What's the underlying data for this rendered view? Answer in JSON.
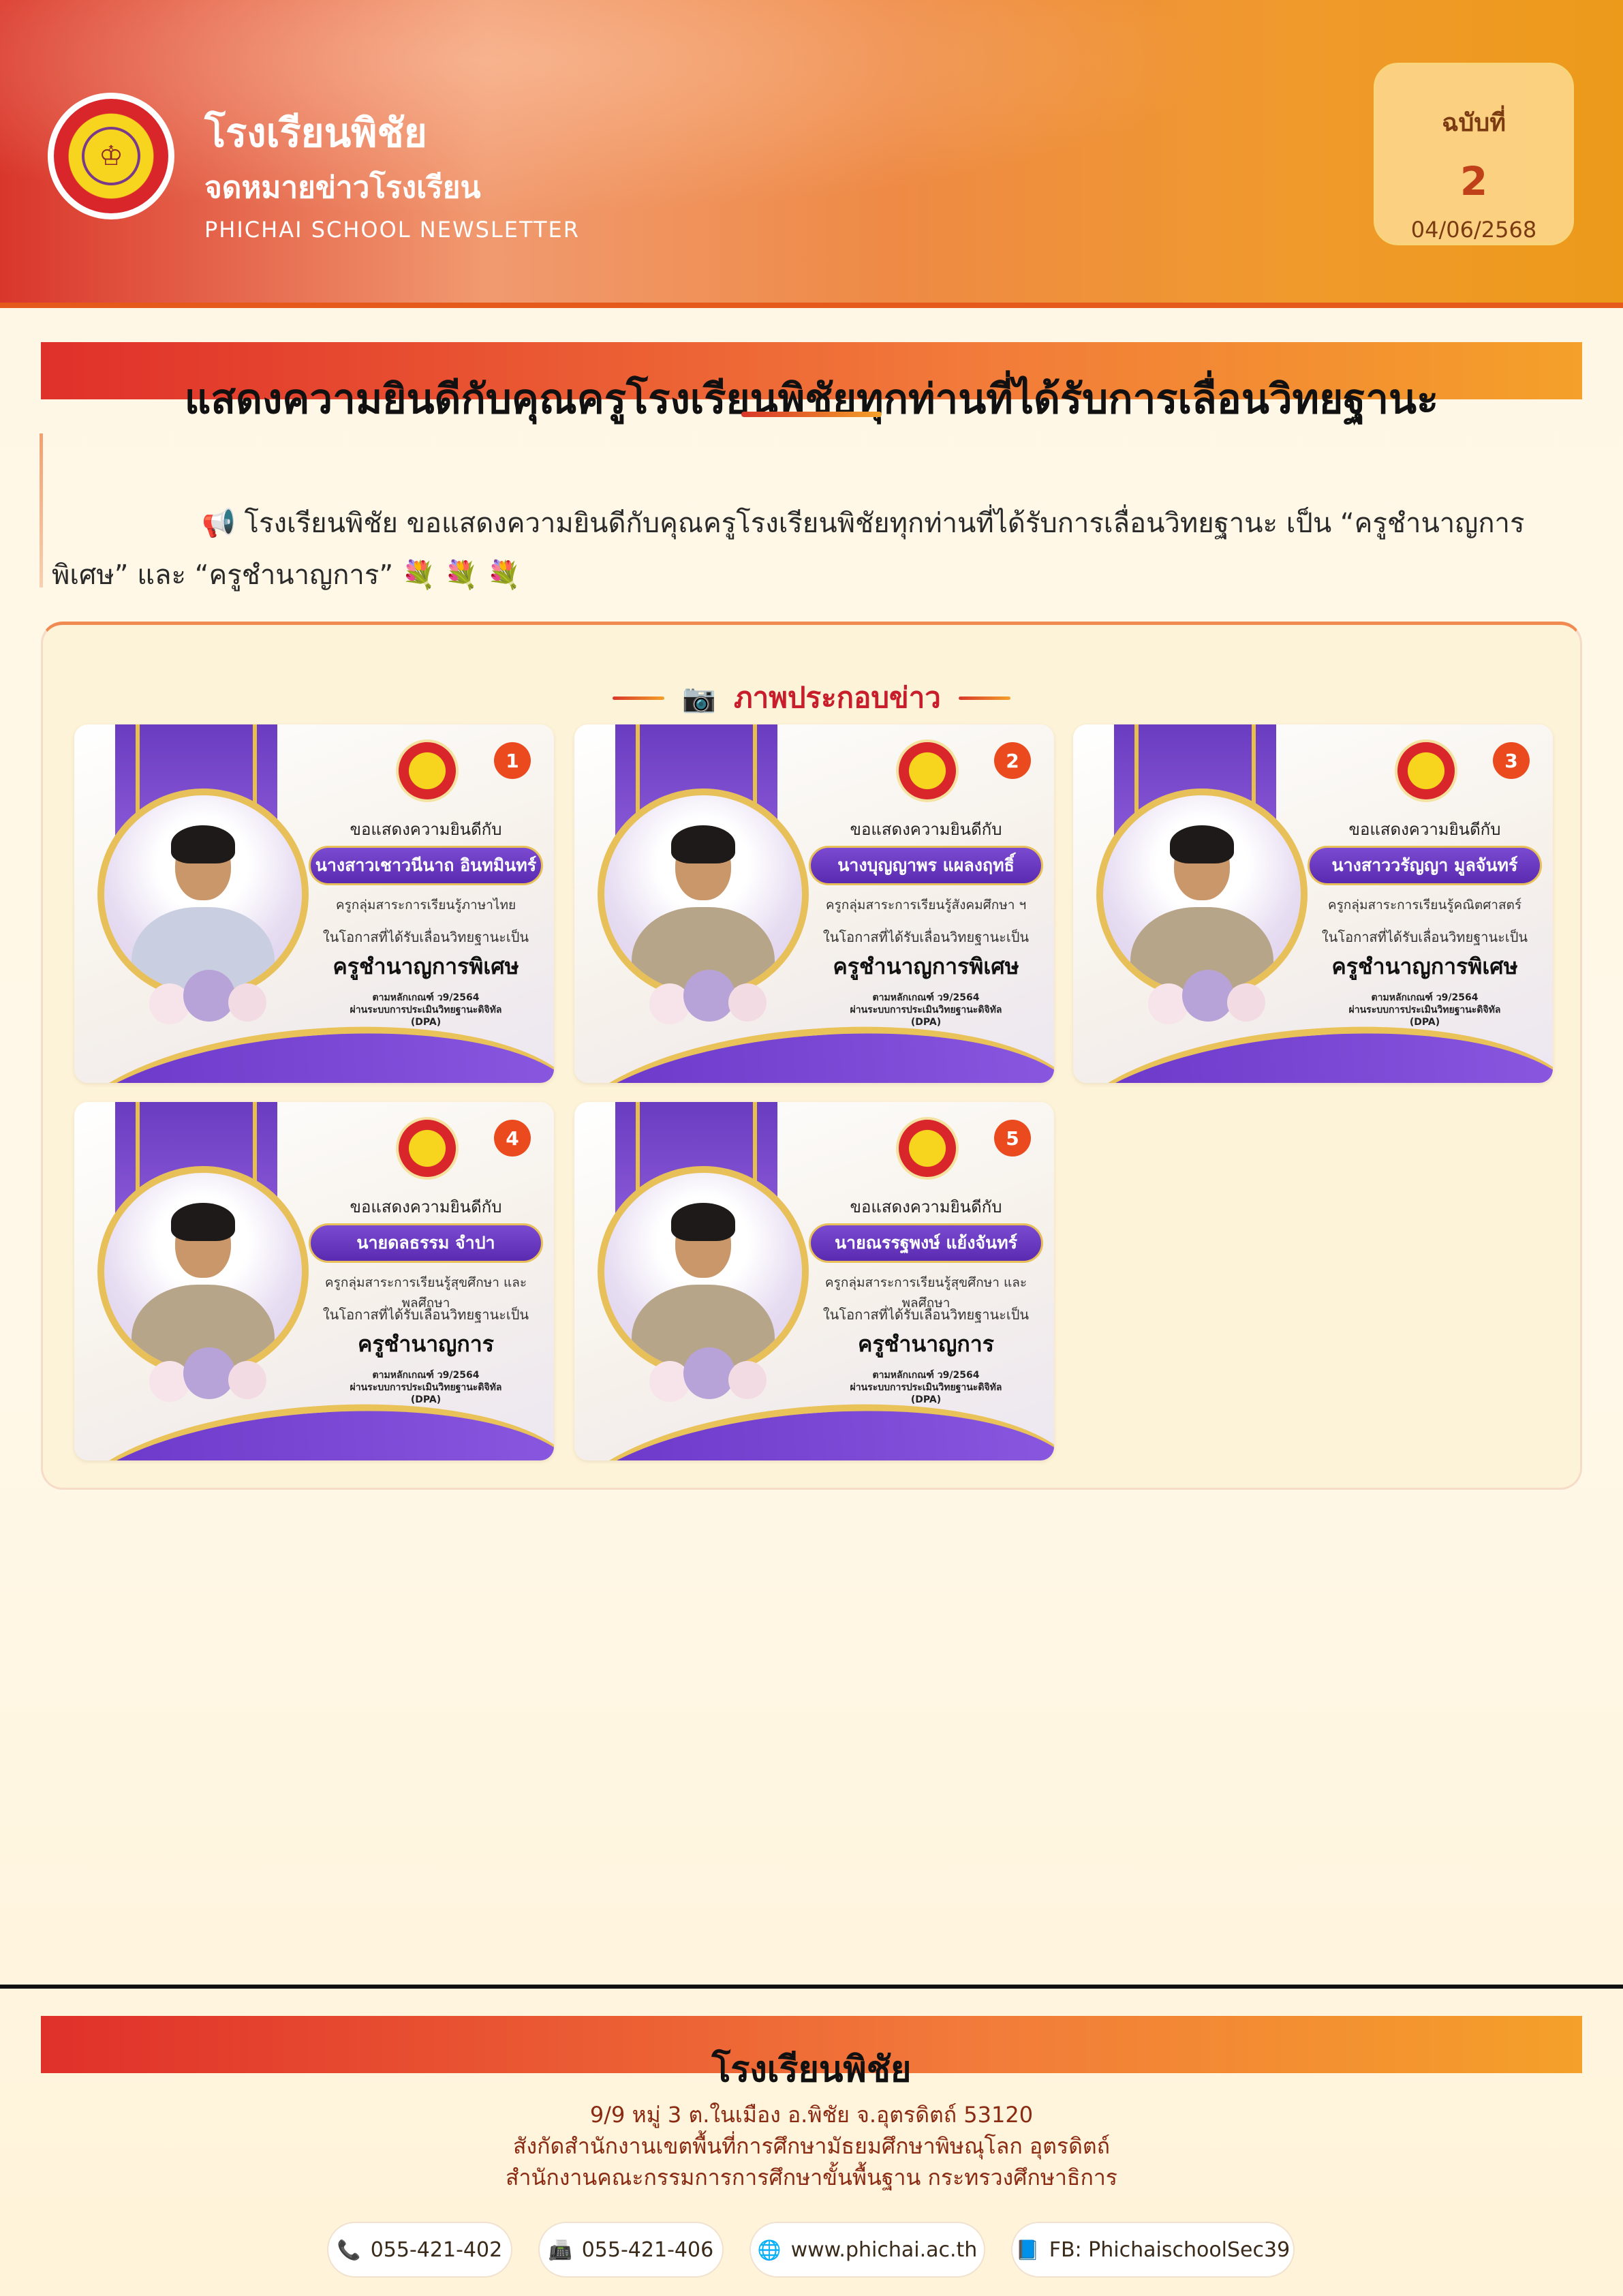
{
  "header": {
    "school_name": "โรงเรียนพิชัย",
    "subtitle": "จดหมายข่าวโรงเรียน",
    "subtitle_en": "PHICHAI SCHOOL NEWSLETTER",
    "issue_label": "ฉบับที่",
    "issue_number": "2",
    "issue_date": "04/06/2568"
  },
  "headline": "แสดงความยินดีกับคุณครูโรงเรียนพิชัยทุกท่านที่ได้รับการเลื่อนวิทยฐานะ",
  "intro": {
    "icon": "megaphone-icon",
    "text": "📢 โรงเรียนพิชัย ขอแสดงความยินดีกับคุณครูโรงเรียนพิชัยทุกท่านที่ได้รับการเลื่อนวิทยฐานะ เป็น “ครูชำนาญการพิเศษ” และ “ครูชำนาญการ” 💐 💐 💐"
  },
  "gallery": {
    "heading": "ภาพประกอบข่าว",
    "heading_icon": "camera-icon",
    "cards": [
      {
        "badge": "1",
        "line1": "ขอแสดงความยินดีกับ",
        "name": "นางสาวเชาวนีนาถ อินทมินทร์",
        "subject": "ครูกลุ่มสาระการเรียนรู้ภาษาไทย",
        "occasion": "ในโอกาสที่ได้รับเลื่อนวิทยฐานะเป็น",
        "rank": "ครูชำนาญการพิเศษ",
        "criteria_1": "ตามหลักเกณฑ์ ว9/2564",
        "criteria_2": "ผ่านระบบการประเมินวิทยฐานะดิจิทัล",
        "criteria_3": "(DPA)"
      },
      {
        "badge": "2",
        "line1": "ขอแสดงความยินดีกับ",
        "name": "นางบุญญาพร แผลงฤทธิ์",
        "subject": "ครูกลุ่มสาระการเรียนรู้สังคมศึกษา ฯ",
        "occasion": "ในโอกาสที่ได้รับเลื่อนวิทยฐานะเป็น",
        "rank": "ครูชำนาญการพิเศษ",
        "criteria_1": "ตามหลักเกณฑ์ ว9/2564",
        "criteria_2": "ผ่านระบบการประเมินวิทยฐานะดิจิทัล",
        "criteria_3": "(DPA)"
      },
      {
        "badge": "3",
        "line1": "ขอแสดงความยินดีกับ",
        "name": "นางสาววรัญญา มูลจันทร์",
        "subject": "ครูกลุ่มสาระการเรียนรู้คณิตศาสตร์",
        "occasion": "ในโอกาสที่ได้รับเลื่อนวิทยฐานะเป็น",
        "rank": "ครูชำนาญการพิเศษ",
        "criteria_1": "ตามหลักเกณฑ์ ว9/2564",
        "criteria_2": "ผ่านระบบการประเมินวิทยฐานะดิจิทัล",
        "criteria_3": "(DPA)"
      },
      {
        "badge": "4",
        "line1": "ขอแสดงความยินดีกับ",
        "name": "นายดลธรรม จำปา",
        "subject": "ครูกลุ่มสาระการเรียนรู้สุขศึกษา และพลศึกษา",
        "occasion": "ในโอกาสที่ได้รับเลื่อนวิทยฐานะเป็น",
        "rank": "ครูชำนาญการ",
        "criteria_1": "ตามหลักเกณฑ์ ว9/2564",
        "criteria_2": "ผ่านระบบการประเมินวิทยฐานะดิจิทัล",
        "criteria_3": "(DPA)"
      },
      {
        "badge": "5",
        "line1": "ขอแสดงความยินดีกับ",
        "name": "นายณรรฐพงษ์ แย้งจันทร์",
        "subject": "ครูกลุ่มสาระการเรียนรู้สุขศึกษา และพลศึกษา",
        "occasion": "ในโอกาสที่ได้รับเลื่อนวิทยฐานะเป็น",
        "rank": "ครูชำนาญการ",
        "criteria_1": "ตามหลักเกณฑ์ ว9/2564",
        "criteria_2": "ผ่านระบบการประเมินวิทยฐานะดิจิทัล",
        "criteria_3": "(DPA)"
      }
    ]
  },
  "footer": {
    "school_name": "โรงเรียนพิชัย",
    "address": "9/9 หมู่ 3 ต.ในเมือง อ.พิชัย จ.อุตรดิตถ์ 53120",
    "affiliation": "สังกัดสำนักงานเขตพื้นที่การศึกษามัธยมศึกษาพิษณุโลก อุตรดิตถ์",
    "office": "สำนักงานคณะกรรมการการศึกษาขั้นพื้นฐาน กระทรวงศึกษาธิการ",
    "contacts": {
      "phone": "055-421-402",
      "fax": "055-421-406",
      "website": "www.phichai.ac.th",
      "facebook": "FB: PhichaischoolSec39"
    }
  },
  "colors": {
    "accent_red": "#d9362b",
    "accent_orange": "#f4a02a",
    "card_purple": "#6a3cc0",
    "card_gold": "#e8c05a"
  }
}
